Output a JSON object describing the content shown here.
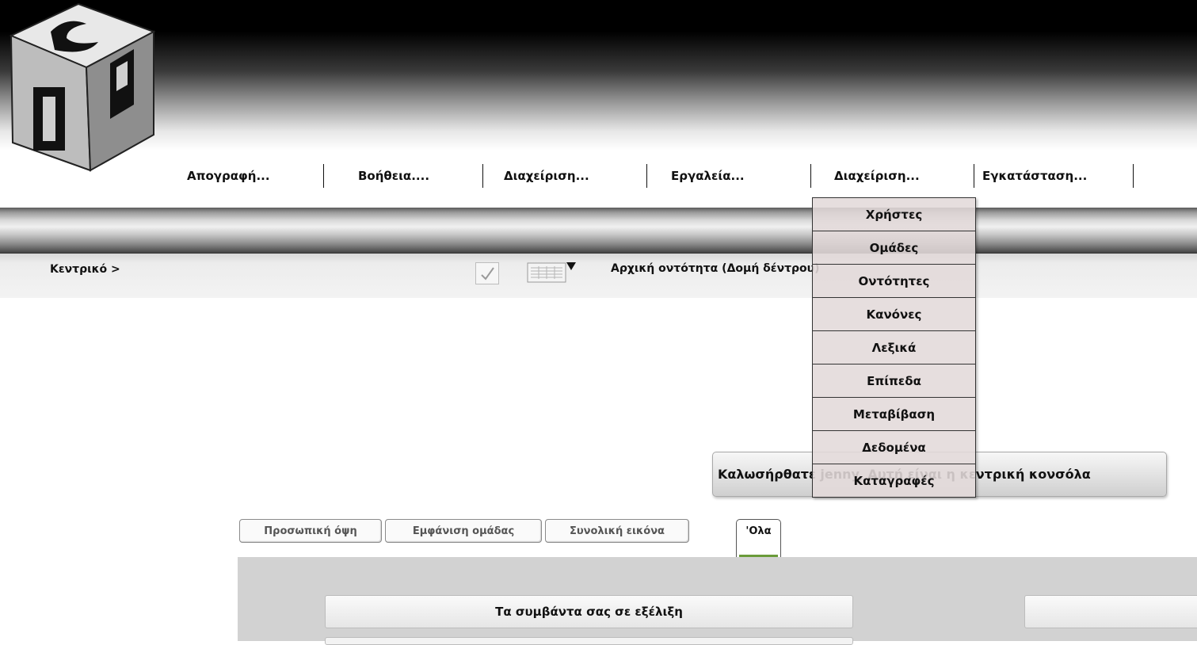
{
  "menu": [
    {
      "label": "Απογραφή..."
    },
    {
      "label": "Βοήθεια...."
    },
    {
      "label": "Διαχείριση..."
    },
    {
      "label": "Εργαλεία..."
    },
    {
      "label": "Διαχείριση..."
    },
    {
      "label": "Εγκατάσταση..."
    }
  ],
  "dropdown": {
    "items": [
      {
        "label": "Χρήστες"
      },
      {
        "label": "Ομάδες"
      },
      {
        "label": "Οντότητες"
      },
      {
        "label": "Κανόνες"
      },
      {
        "label": "Λεξικά"
      },
      {
        "label": "Επίπεδα"
      },
      {
        "label": "Μεταβίβαση"
      },
      {
        "label": "Δεδομένα"
      },
      {
        "label": "Καταγραφές"
      }
    ]
  },
  "breadcrumb": {
    "label": "Κεντρικό >"
  },
  "toolbar": {
    "root_entity": "Αρχική οντότητα (Δομή δέντρου)"
  },
  "welcome": {
    "text": "Καλωσήρθατε jenny, Αυτή είναι η κεντρική κονσόλα"
  },
  "tabs": [
    {
      "label": "Προσωπική όψη"
    },
    {
      "label": "Εμφάνιση ομάδας"
    },
    {
      "label": "Συνολική εικόνα"
    }
  ],
  "tab_all": {
    "label": "'Ολα"
  },
  "panel": {
    "events_title": "Τα συμβάντα σας σε εξέλιξη"
  }
}
